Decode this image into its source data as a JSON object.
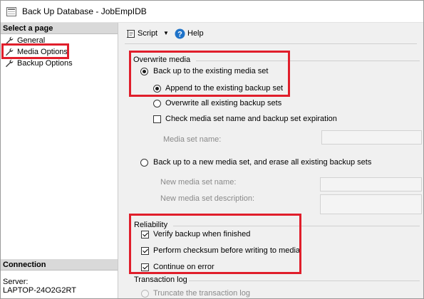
{
  "window": {
    "title": "Back Up Database - JobEmpIDB"
  },
  "left_pane": {
    "select_page_header": "Select a page",
    "pages": [
      {
        "label": "General",
        "icon": "wrench-icon"
      },
      {
        "label": "Media Options",
        "icon": "wrench-icon",
        "highlighted": true
      },
      {
        "label": "Backup Options",
        "icon": "wrench-icon"
      }
    ],
    "connection_header": "Connection",
    "server_label": "Server:",
    "server_value": "LAPTOP-24O2G2RT"
  },
  "toolbar": {
    "script_label": "Script",
    "help_label": "Help"
  },
  "overwrite_media": {
    "title": "Overwrite media",
    "backup_existing_label": "Back up to the existing media set",
    "backup_existing_selected": true,
    "append_label": "Append to the existing backup set",
    "append_selected": true,
    "overwrite_label": "Overwrite all existing backup sets",
    "overwrite_selected": false,
    "check_media_label": "Check media set name and backup set expiration",
    "check_media_checked": false,
    "media_set_name_label": "Media set name:",
    "media_set_name_value": "",
    "new_media_label": "Back up to a new media set, and erase all existing backup sets",
    "new_media_selected": false,
    "new_media_name_label": "New media set name:",
    "new_media_name_value": "",
    "new_media_desc_label": "New media set description:",
    "new_media_desc_value": ""
  },
  "reliability": {
    "title": "Reliability",
    "verify_label": "Verify backup when finished",
    "verify_checked": true,
    "checksum_label": "Perform checksum before writing to media",
    "checksum_checked": true,
    "continue_label": "Continue on error",
    "continue_checked": true
  },
  "transaction_log": {
    "title": "Transaction log",
    "truncate_label": "Truncate the transaction log"
  },
  "colors": {
    "highlight_border": "#e01e2b",
    "help_icon": "#1e72c8"
  }
}
